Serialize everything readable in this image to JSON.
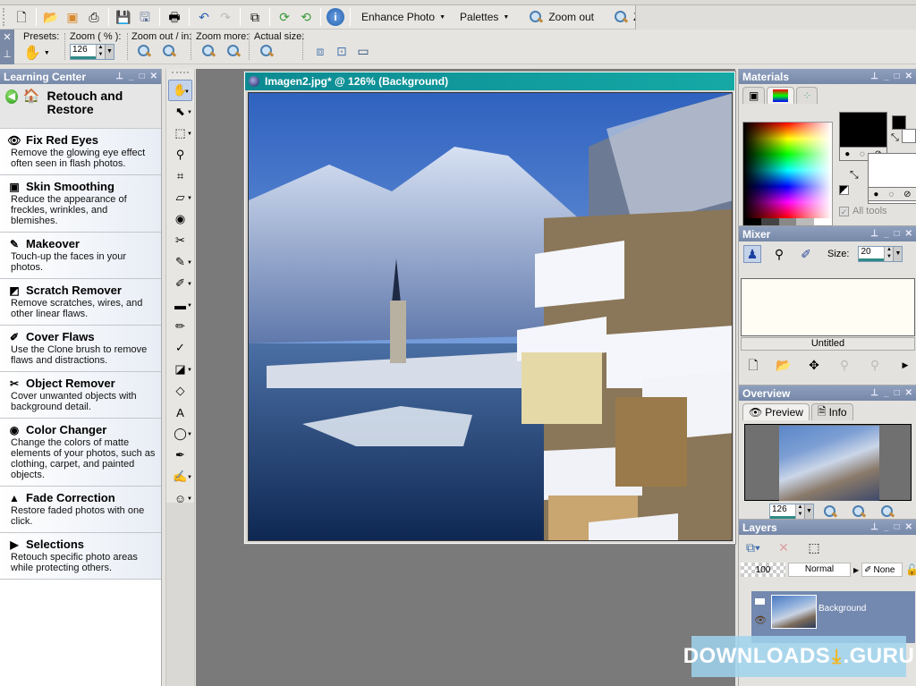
{
  "toolbar_main": {
    "icons": [
      "new-file-icon",
      "open-icon",
      "browse-icon",
      "scan-icon",
      "save-icon",
      "save-as-icon",
      "print-icon",
      "undo-icon",
      "redo-icon",
      "full-editor-icon",
      "rotate-right-icon",
      "rotate-left-icon",
      "info-icon"
    ],
    "enhance_photo": "Enhance Photo",
    "palettes": "Palettes",
    "zoom_out": "Zoom out",
    "zoom_in": "Zoom in"
  },
  "toolbar_tool_options": {
    "presets_label": "Presets:",
    "zoom_label": "Zoom ( % ):",
    "zoom_value": "126",
    "zoom_out_in_label": "Zoom out / in:",
    "zoom_more_label": "Zoom more:",
    "actual_size_label": "Actual size:"
  },
  "learning_center": {
    "title": "Learning Center",
    "header": "Retouch and Restore",
    "items": [
      {
        "title": "Fix Red Eyes",
        "desc": "Remove the glowing eye effect often seen in flash photos.",
        "icon": "👁"
      },
      {
        "title": "Skin Smoothing",
        "desc": "Reduce the appearance of freckles, wrinkles, and blemishes.",
        "icon": "▣"
      },
      {
        "title": "Makeover",
        "desc": "Touch-up the faces in your photos.",
        "icon": "✎"
      },
      {
        "title": "Scratch Remover",
        "desc": "Remove scratches, wires, and other linear flaws.",
        "icon": "◩"
      },
      {
        "title": "Cover Flaws",
        "desc": "Use the Clone brush to remove flaws and distractions.",
        "icon": "✐"
      },
      {
        "title": "Object Remover",
        "desc": "Cover unwanted objects with background detail.",
        "icon": "✂"
      },
      {
        "title": "Color Changer",
        "desc": "Change the colors of matte elements of your photos, such as clothing, carpet, and painted objects.",
        "icon": "◉"
      },
      {
        "title": "Fade Correction",
        "desc": "Restore faded photos with one click.",
        "icon": "▲"
      },
      {
        "title": "Selections",
        "desc": "Retouch specific photo areas while protecting others.",
        "icon": "▶"
      }
    ]
  },
  "tools": [
    {
      "name": "pan-tool",
      "glyph": "✋",
      "dd": true,
      "sel": true
    },
    {
      "name": "pick-tool",
      "glyph": "⬉",
      "dd": true
    },
    {
      "name": "selection-tool",
      "glyph": "⬚",
      "dd": true
    },
    {
      "name": "dropper-tool",
      "glyph": "⚲"
    },
    {
      "name": "crop-tool",
      "glyph": "⌗"
    },
    {
      "name": "straighten-tool",
      "glyph": "▱",
      "dd": true
    },
    {
      "name": "red-eye-tool",
      "glyph": "◉"
    },
    {
      "name": "makeover-tool",
      "glyph": "✂"
    },
    {
      "name": "clone-brush-tool",
      "glyph": "✎",
      "dd": true
    },
    {
      "name": "dodge-tool",
      "glyph": "✐",
      "dd": true
    },
    {
      "name": "gradient-tool",
      "glyph": "▬",
      "dd": true
    },
    {
      "name": "paint-brush-tool",
      "glyph": "✏"
    },
    {
      "name": "color-replacer-tool",
      "glyph": "✓"
    },
    {
      "name": "flood-fill-tool",
      "glyph": "◪",
      "dd": true
    },
    {
      "name": "eraser-tool",
      "glyph": "◇"
    },
    {
      "name": "text-tool",
      "glyph": "A"
    },
    {
      "name": "preset-shape-tool",
      "glyph": "◯",
      "dd": true
    },
    {
      "name": "pen-tool",
      "glyph": "✒"
    },
    {
      "name": "art-media-tool",
      "glyph": "✍",
      "dd": true
    },
    {
      "name": "palette-knife-tool",
      "glyph": "☺",
      "dd": true
    }
  ],
  "document": {
    "title": "Imagen2.jpg* @ 126% (Background)"
  },
  "materials": {
    "title": "Materials",
    "all_tools_label": "All tools",
    "foreground_color": "#000000",
    "background_color": "#ffffff"
  },
  "mixer": {
    "title": "Mixer",
    "size_label": "Size:",
    "size_value": "20",
    "canvas_name": "Untitled"
  },
  "overview": {
    "title": "Overview",
    "tab_preview": "Preview",
    "tab_info": "Info",
    "zoom_value": "126"
  },
  "layers": {
    "title": "Layers",
    "opacity": "100",
    "blend_mode": "Normal",
    "mask": "None",
    "layer_name": "Background"
  },
  "watermark": {
    "text_left": "DOWNLOADS",
    "text_right": ".GURU"
  }
}
